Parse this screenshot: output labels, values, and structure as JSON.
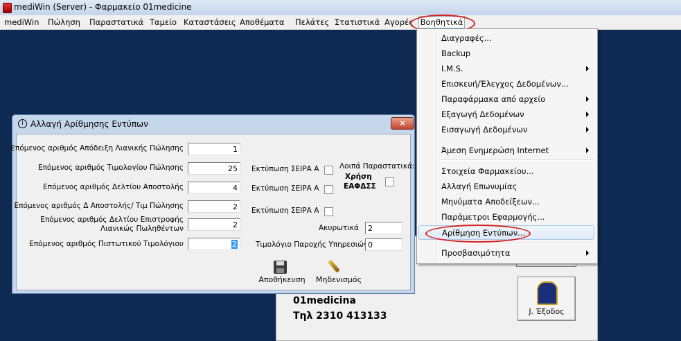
{
  "window": {
    "title": "mediWin (Server) - Φαρμακείο 01medicine"
  },
  "menubar": {
    "items": [
      "mediWin",
      "Πώληση",
      "Παραστατικά",
      "Ταμείο",
      "Καταστάσεις",
      "Αποθέματα",
      "Πελάτες",
      "Στατιστικά",
      "Αγορές"
    ],
    "active": "Βοηθητικά"
  },
  "help_menu": {
    "items": [
      "Διαγραφές...",
      "Backup",
      "I.M.S.",
      "Επισκευή/Έλεγχος Δεδομένων...",
      "Παραφάρμακα από αρχείο",
      "Εξαγωγή Δεδομένων",
      "Εισαγωγή Δεδομένων",
      "Άμεση Ενημερώση Internet",
      "Στοιχεία Φαρμακείου...",
      "Αλλαγή Επωνυμίας",
      "Μηνύματα Αποδείξεων...",
      "Παράμετροι Εφαρμογής...",
      "Αρίθμηση Εντύπων...",
      "Προσβασιμότητα"
    ],
    "highlighted": "Αρίθμηση Εντύπων..."
  },
  "dialog": {
    "title": "Αλλαγή Αρίθμησης Εντύπων",
    "close": "✕",
    "fields": [
      {
        "label": "Επόμενος αριθμός Απόδειξη Λιανικής Πώλησης",
        "value": "1"
      },
      {
        "label": "Επόμενος αριθμός Τιμολογίου Πώλησης",
        "value": "25"
      },
      {
        "label": "Επόμενος αριθμός Δελτίου Αποστολής",
        "value": "4"
      },
      {
        "label": "Επόμενος αριθμός Δ Αποστολής/ Τιμ Πώλησης",
        "value": "2"
      },
      {
        "label_line1": "Επόμενος αριθμός Δελτίου Επιστροφής",
        "label_line2": "Λιανικώς Πωληθέντων",
        "value": "2"
      },
      {
        "label": "Επόμενος αριθμός Πιστωτικού Τιμολόγιου",
        "value": "2"
      }
    ],
    "print_series_label": "Εκτύπωση ΣΕΙΡΑ Α",
    "other_docs_label": "Λοιπά Παραστατικά:",
    "efdss_line1": "Χρήση",
    "efdss_line2": "ΕΑΦΔΣΣ",
    "void_label": "Ακυρωτικά",
    "void_value": "2",
    "service_invoice_label": "Τιμολόγιο Παροχής Υπηρεσιών",
    "service_invoice_value": "0",
    "save_label": "Αποθήκευση",
    "clear_label": "Μηδενισμός"
  },
  "background": {
    "pharmacy_name": "01medicina",
    "phone": "Τηλ 2310 413133",
    "exit_label": "J. Έξοδος"
  },
  "colors": {
    "desktop": "#0e2a52",
    "highlight_oval": "#d42020",
    "selection": "#3399ff"
  }
}
